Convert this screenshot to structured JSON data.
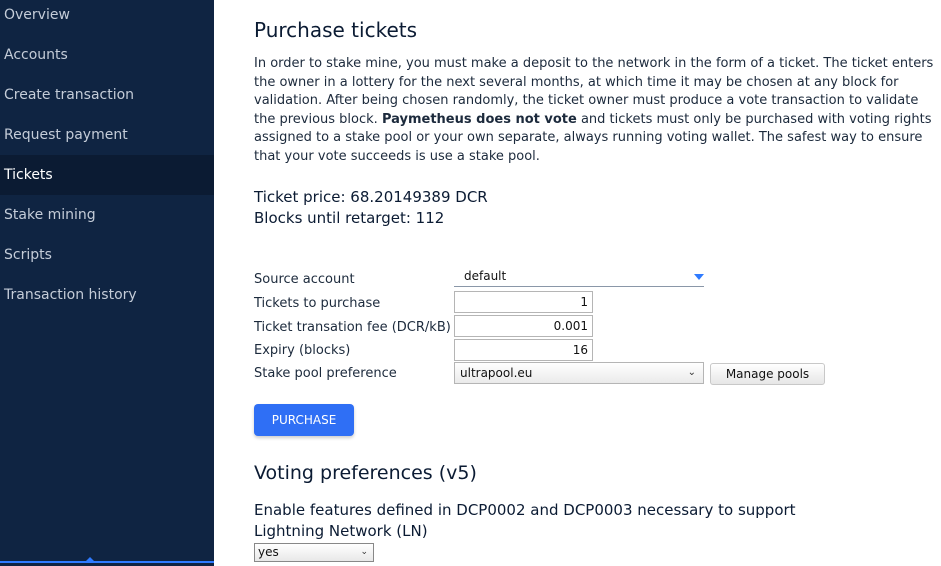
{
  "sidebar": {
    "items": [
      {
        "label": "Overview"
      },
      {
        "label": "Accounts"
      },
      {
        "label": "Create transaction"
      },
      {
        "label": "Request payment"
      },
      {
        "label": "Tickets"
      },
      {
        "label": "Stake mining"
      },
      {
        "label": "Scripts"
      },
      {
        "label": "Transaction history"
      }
    ],
    "active": "Tickets"
  },
  "purchase": {
    "title": "Purchase tickets",
    "intro_part1": "In order to stake mine, you must make a deposit to the network in the form of a ticket. The ticket enters the owner in a lottery for the next several months, at which time it may be chosen at any block for validation. After being chosen randomly, the ticket owner must produce a vote transaction to validate the previous block.",
    "intro_bold": "Paymetheus does not vote",
    "intro_part2": "and tickets must only be purchased with voting rights assigned to a stake pool or your own separate, always running voting wallet. The safest way to ensure that your vote succeeds is use a stake pool.",
    "ticket_price": "Ticket price: 68.20149389 DCR",
    "blocks_until_retarget": "Blocks until retarget: 112",
    "form": {
      "source_account_label": "Source account",
      "source_account_value": "default",
      "tickets_label": "Tickets to purchase",
      "tickets_value": "1",
      "fee_label": "Ticket transation fee (DCR/kB)",
      "fee_value": "0.001",
      "expiry_label": "Expiry (blocks)",
      "expiry_value": "16",
      "pool_label": "Stake pool preference",
      "pool_value": "ultrapool.eu",
      "manage_pools": "Manage pools",
      "purchase_button": "PURCHASE"
    }
  },
  "voting": {
    "title": "Voting preferences (v5)",
    "description": "Enable features defined in DCP0002 and DCP0003 necessary to support Lightning Network (LN)",
    "value": "yes"
  },
  "colors": {
    "sidebar_bg": "#0f2442",
    "sidebar_active_bg": "#0b1b33",
    "accent": "#2f6ff5"
  }
}
